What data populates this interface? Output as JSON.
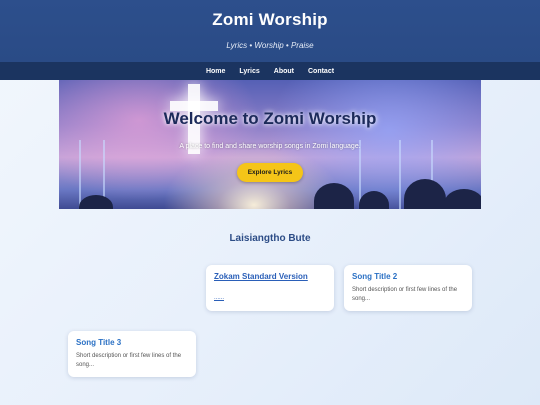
{
  "header": {
    "title": "Zomi Worship",
    "tagline": "Lyrics • Worship • Praise"
  },
  "nav": {
    "items": [
      {
        "label": "Home"
      },
      {
        "label": "Lyrics"
      },
      {
        "label": "About"
      },
      {
        "label": "Contact"
      }
    ]
  },
  "hero": {
    "title": "Welcome to Zomi Worship",
    "subtitle": "A place to find and share worship songs in Zomi language.",
    "button_label": "Explore Lyrics"
  },
  "section": {
    "title": "Laisiangtho Bute"
  },
  "cards": [
    {
      "title": "Zokam Standard Version",
      "link_text": "......"
    },
    {
      "title": "Song Title 2",
      "description": "Short description or first few lines of the song..."
    },
    {
      "title": "Song Title 3",
      "description": "Short description or first few lines of the song..."
    }
  ],
  "colors": {
    "header_bg": "#2d4f8c",
    "nav_bg": "#1b3460",
    "accent_button": "#f5c518",
    "card_title": "#2a70c4",
    "section_title": "#2c4c86"
  }
}
